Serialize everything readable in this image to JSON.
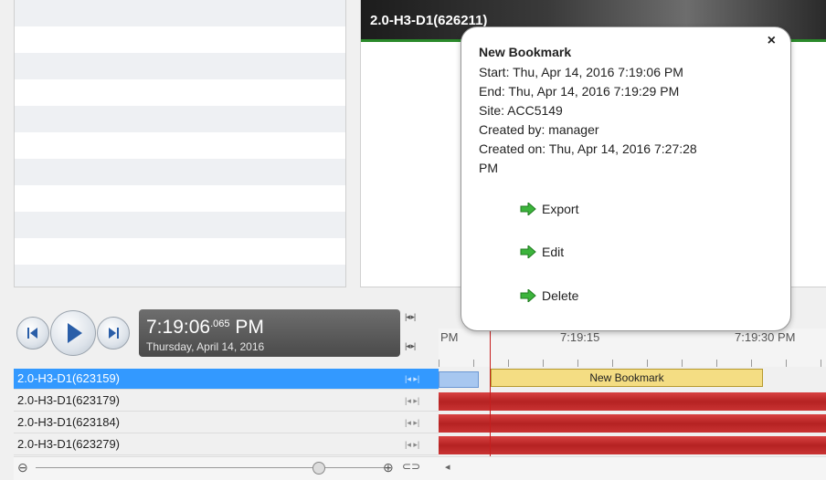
{
  "video": {
    "title": "2.0-H3-D1(626211)"
  },
  "popup": {
    "title": "New Bookmark",
    "start": "Start: Thu, Apr 14, 2016 7:19:06 PM",
    "end": "End: Thu, Apr 14, 2016 7:19:29 PM",
    "site": "Site: ACC5149",
    "created_by": "Created by: manager",
    "created_on": "Created on: Thu, Apr 14, 2016 7:27:28",
    "created_on_cont": "PM",
    "close": "×",
    "actions": {
      "export": "Export",
      "edit": "Edit",
      "delete": "Delete"
    }
  },
  "player": {
    "time": "7:19:06",
    "ms": ".065",
    "ampm": "PM",
    "date": "Thursday, April 14, 2016"
  },
  "ruler": {
    "labels": [
      "PM",
      "7:19:15",
      "7:19:30 PM"
    ]
  },
  "cameras": [
    {
      "name": "2.0-H3-D1(623159)"
    },
    {
      "name": "2.0-H3-D1(623179)"
    },
    {
      "name": "2.0-H3-D1(623184)"
    },
    {
      "name": "2.0-H3-D1(623279)"
    }
  ],
  "bookmark_label": "New Bookmark",
  "colors": {
    "selected": "#3399ff",
    "recording": "#c62a2a",
    "bookmark": "#f4dd83"
  }
}
